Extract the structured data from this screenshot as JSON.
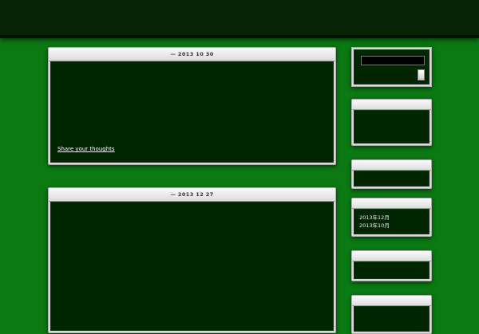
{
  "header": {
    "title": "",
    "description": ""
  },
  "posts": [
    {
      "date": "— 2013  10  30",
      "lines": [
        "",
        "",
        "",
        "",
        ""
      ],
      "share_label": "Share your thoughts"
    },
    {
      "date": "— 2013  12  27",
      "lines": [
        "",
        "",
        "",
        "",
        "",
        "",
        "",
        ""
      ]
    }
  ],
  "sidebar": {
    "search": {
      "placeholder": ""
    },
    "pages": {
      "items": [
        "",
        "",
        ""
      ]
    },
    "archives": {
      "items": [
        "2013年12月",
        "2013年10月"
      ]
    },
    "categories": {
      "items": [
        ""
      ]
    }
  }
}
